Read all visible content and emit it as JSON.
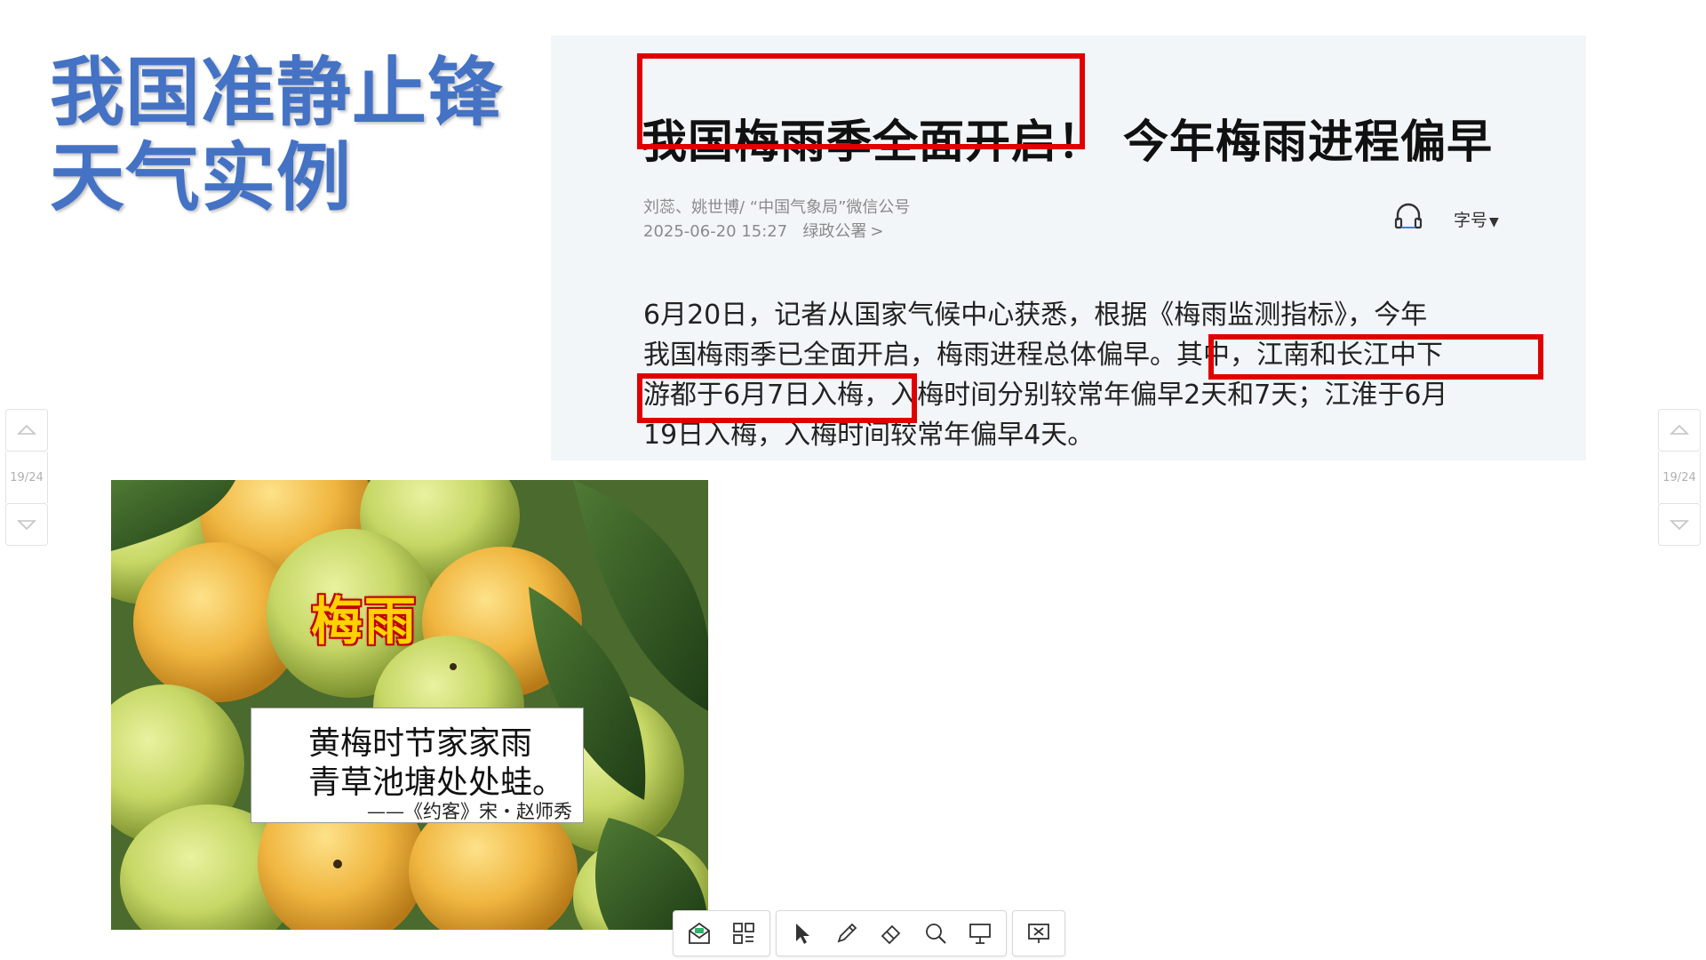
{
  "slide": {
    "title_line1": "我国准静止锋",
    "title_line2": "天气实例"
  },
  "article": {
    "headline_highlighted": "我国梅雨季全面开启！",
    "headline_rest": "今年梅雨进程偏早",
    "authors": "刘蕊、姚世博/ “中国气象局”微信公号",
    "datetime": "2025-06-20 15:27",
    "channel": "绿政公署",
    "channel_arrow": ">",
    "font_size_label": "字号",
    "font_size_caret": "▼",
    "body_line1": "6月20日，记者从国家气候中心获悉，根据《梅雨监测指标》，今年",
    "body_line2": "我国梅雨季已全面开启，梅雨进程总体偏早。其中，江南和长江中下",
    "body_line3": "游都于6月7日入梅，入梅时间分别较常年偏早2天和7天；江淮于6月",
    "body_line4": "19日入梅，入梅时间较常年偏早4天。"
  },
  "photo": {
    "title": "梅雨",
    "poem_line1": "黄梅时节家家雨",
    "poem_line2": "青草池塘处处蛙。",
    "poem_source": "——《约客》宋・赵师秀"
  },
  "pager": {
    "left_page": "19/24",
    "right_page": "19/24"
  },
  "colors": {
    "title_blue": "#4472c4",
    "highlight_red": "#e00000"
  },
  "toolbar_icons": [
    "mail-icon",
    "grid-icon",
    "pointer-icon",
    "pen-icon",
    "eraser-icon",
    "search-icon",
    "screen-icon",
    "exit-slideshow-icon"
  ]
}
